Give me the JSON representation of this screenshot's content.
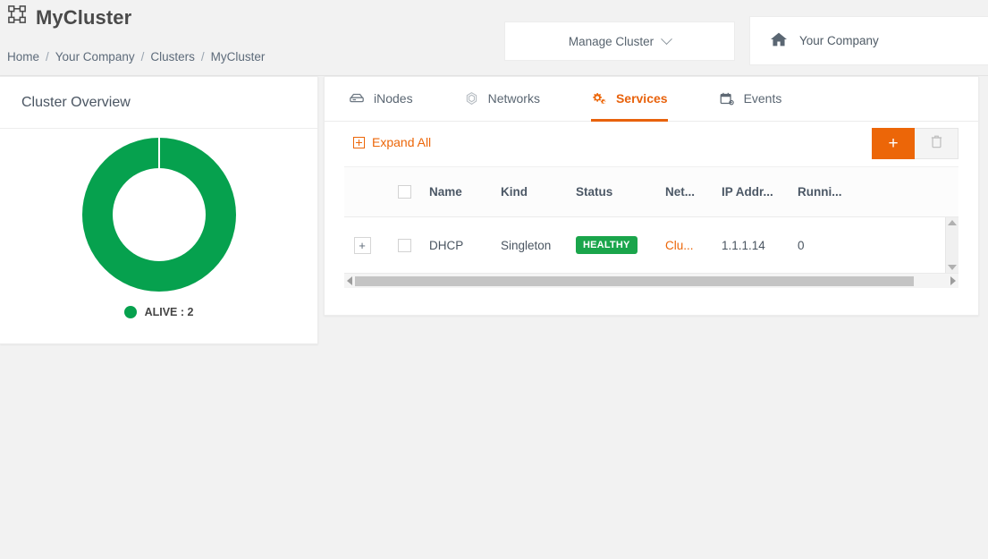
{
  "header": {
    "title": "MyCluster",
    "title_icon": "cluster-icon",
    "breadcrumb": [
      "Home",
      "Your Company",
      "Clusters",
      "MyCluster"
    ],
    "breadcrumb_separator": "/",
    "manage_button": "Manage Cluster",
    "manage_button_icon": "chevron-down-icon",
    "company_button": "Your Company",
    "company_icon": "home-icon"
  },
  "overview": {
    "title": "Cluster Overview",
    "legend_label": "ALIVE : 2"
  },
  "chart_data": {
    "type": "pie",
    "title": "Cluster Overview",
    "subtype": "donut",
    "categories": [
      "ALIVE",
      "ALIVE"
    ],
    "values": [
      1,
      1
    ],
    "labels": [
      "ALIVE : 2"
    ],
    "colors": [
      "#06a14e",
      "#06a14e"
    ],
    "legend": [
      "ALIVE : 2"
    ],
    "legend_position": "bottom",
    "total": 2,
    "grid": false
  },
  "tabs": [
    {
      "label": "iNodes",
      "icon": "server-icon",
      "active": false
    },
    {
      "label": "Networks",
      "icon": "network-icon",
      "active": false
    },
    {
      "label": "Services",
      "icon": "gears-icon",
      "active": true
    },
    {
      "label": "Events",
      "icon": "calendar-icon",
      "active": false
    }
  ],
  "toolbar": {
    "expand_all": "Expand All",
    "expand_all_icon": "box-plus-icon",
    "add_label": "+",
    "add_icon": "plus-icon",
    "delete_icon": "trash-icon"
  },
  "table": {
    "columns": [
      "Name",
      "Kind",
      "Status",
      "Net...",
      "IP Addr...",
      "Runni..."
    ],
    "rows": [
      {
        "expander": "+",
        "name": "DHCP",
        "kind": "Singleton",
        "status": "HEALTHY",
        "network": "Clu...",
        "ip_address": "1.1.1.14",
        "running": "0"
      }
    ]
  },
  "colors": {
    "accent_orange": "#ec6608",
    "status_green": "#1aa54b",
    "donut_green": "#06a14e",
    "page_bg": "#f2f2f2"
  }
}
